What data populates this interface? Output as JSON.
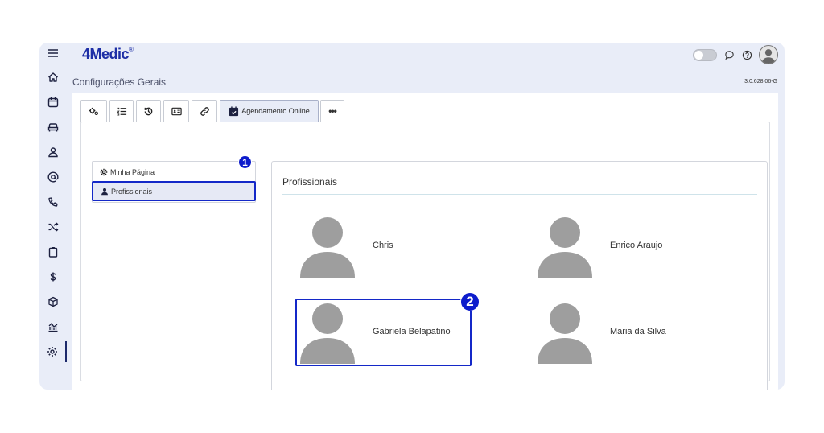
{
  "app": {
    "logo_text": "4Medic",
    "logo_mark": "®",
    "page_title": "Configurações Gerais",
    "version": "3.0.628.06-G"
  },
  "sidebar": {
    "items": [
      {
        "icon": "menu-icon"
      },
      {
        "icon": "home-icon"
      },
      {
        "icon": "calendar-icon"
      },
      {
        "icon": "sofa-icon"
      },
      {
        "icon": "user-icon"
      },
      {
        "icon": "at-icon"
      },
      {
        "icon": "phone-icon"
      },
      {
        "icon": "shuffle-icon"
      },
      {
        "icon": "clipboard-icon"
      },
      {
        "icon": "dollar-icon"
      },
      {
        "icon": "box-icon"
      },
      {
        "icon": "chart-icon"
      },
      {
        "icon": "gear-icon",
        "active": true
      }
    ]
  },
  "tabs": {
    "items": [
      {
        "icon": "gears-icon"
      },
      {
        "icon": "list-icon"
      },
      {
        "icon": "history-icon"
      },
      {
        "icon": "id-card-icon"
      },
      {
        "icon": "link-icon"
      },
      {
        "icon": "calendar-check-icon",
        "label": "Agendamento Online",
        "active": true
      },
      {
        "icon": "more-icon",
        "label": "•••"
      }
    ]
  },
  "left_menu": {
    "items": [
      {
        "label": "Minha Página",
        "icon": "gear-icon"
      },
      {
        "label": "Profissionais",
        "icon": "users-icon",
        "selected": true
      }
    ]
  },
  "professionals": {
    "title": "Profissionais",
    "items": [
      {
        "name": "Chris"
      },
      {
        "name": "Enrico Araujo"
      },
      {
        "name": "Gabriela Belapatino"
      },
      {
        "name": "Maria da Silva"
      }
    ]
  },
  "annotations": {
    "badge_1": "1",
    "badge_2": "2"
  },
  "colors": {
    "accent": "#1428c8",
    "badge": "#0d1ccc",
    "logo": "#1e2fa6",
    "app_bg": "#e9edf8",
    "avatar": "#9e9e9e"
  }
}
